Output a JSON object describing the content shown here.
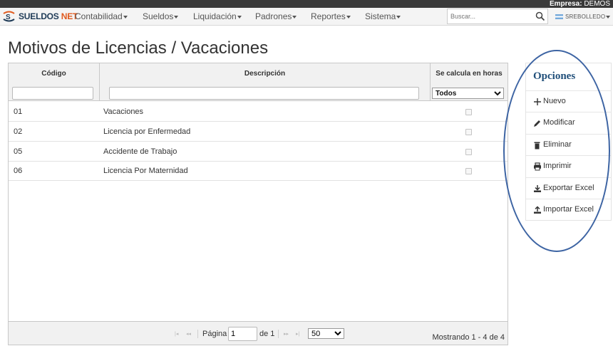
{
  "empresa": {
    "label": "Empresa:",
    "value": "DEMOS"
  },
  "brand": {
    "name_a": "SUELDOS",
    "name_b": "NET"
  },
  "nav": {
    "items": [
      "Contabilidad",
      "Sueldos",
      "Liquidación",
      "Padrones",
      "Reportes",
      "Sistema"
    ],
    "search_placeholder": "Buscar...",
    "user": "SREBOLLEDO"
  },
  "page": {
    "title": "Motivos de Licencias / Vacaciones"
  },
  "grid": {
    "headers": {
      "codigo": "Código",
      "descripcion": "Descripción",
      "horas": "Se calcula en horas"
    },
    "horas_filter": "Todos",
    "rows": [
      {
        "codigo": "01",
        "descripcion": "Vacaciones",
        "horas": false
      },
      {
        "codigo": "02",
        "descripcion": "Licencia por Enfermedad",
        "horas": false
      },
      {
        "codigo": "05",
        "descripcion": "Accidente de Trabajo",
        "horas": false
      },
      {
        "codigo": "06",
        "descripcion": "Licencia Por Maternidad",
        "horas": false
      }
    ],
    "pager": {
      "page_label": "Página",
      "page": "1",
      "of_label": "de 1",
      "page_size": "50",
      "summary": "Mostrando 1 - 4 de 4"
    }
  },
  "opciones": {
    "title": "Opciones",
    "items": [
      {
        "label": "Nuevo",
        "icon": "plus-icon"
      },
      {
        "label": "Modificar",
        "icon": "pencil-icon"
      },
      {
        "label": "Eliminar",
        "icon": "trash-icon"
      },
      {
        "label": "Imprimir",
        "icon": "printer-icon"
      },
      {
        "label": "Exportar Excel",
        "icon": "download-icon"
      },
      {
        "label": "Importar Excel",
        "icon": "upload-icon"
      }
    ]
  },
  "colors": {
    "accent": "#1f4e79",
    "brand_orange": "#e05a1e",
    "annotation": "#3d64a3"
  }
}
